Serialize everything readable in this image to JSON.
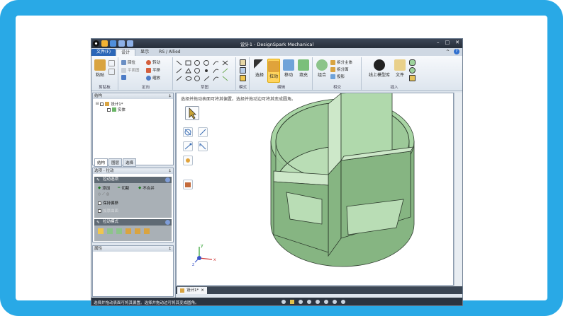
{
  "app": {
    "title": "设计1 - DesignSpark Mechanical",
    "window_controls": [
      "–",
      "□",
      "✕"
    ]
  },
  "menu": {
    "tabs": [
      "文件(F)",
      "设计",
      "显示",
      "RS / Allied"
    ],
    "right": [
      "^",
      "?"
    ]
  },
  "ribbon": {
    "clipboard": {
      "paste": "粘贴",
      "group": "剪贴板"
    },
    "orient": {
      "items": [
        "回位",
        "平面图",
        "转动",
        "平移",
        "缩放"
      ],
      "group": "定向"
    },
    "sketch": {
      "group": "草图"
    },
    "mode": {
      "group": "模式"
    },
    "edit": {
      "select": "选择",
      "pull": "拉动",
      "move": "移动",
      "fill": "填充",
      "group": "编辑"
    },
    "intersect": {
      "combine": "组合",
      "split_body": "拆分主体",
      "split_face": "拆分面",
      "project": "投影",
      "group": "相交"
    },
    "insert": {
      "online_library": "线上模型库",
      "file": "文件",
      "group": "插入"
    }
  },
  "structure_panel": {
    "title": "结构",
    "pin": "‡",
    "tree": [
      {
        "label": "设计1*"
      },
      {
        "label": "实体"
      }
    ],
    "tabs": [
      "结构",
      "图层",
      "选择"
    ]
  },
  "options_panel": {
    "title": "选项 - 拉动",
    "pin": "‡",
    "sections": [
      {
        "title": "拉动选项",
        "items": [
          "添加",
          "切割",
          "不合并",
          "保持偏移",
          "加厚曲面"
        ]
      },
      {
        "title": "拉动模式",
        "items": []
      }
    ]
  },
  "properties_panel": {
    "title": "属性",
    "pin": "‡"
  },
  "viewport": {
    "hint": "选择并拖动表面可将其偏置。选择并拖动边可将其变成圆角。",
    "axis_labels": {
      "x": "x",
      "y": "y",
      "z": "z"
    }
  },
  "document_tab": {
    "label": "设计1*",
    "close": "✕"
  },
  "statusbar": {
    "message": "选择并拖动表面可将其偏置。选择并拖动边可将其变成圆角。"
  },
  "colors": {
    "slide_border": "#29a9e6",
    "model_face": "#a8d5a4",
    "model_edge": "#2d3b2d",
    "model_shadow": "#6f9b6b",
    "status_bar": "#2b3440",
    "active_tool": "#ffd45e"
  }
}
